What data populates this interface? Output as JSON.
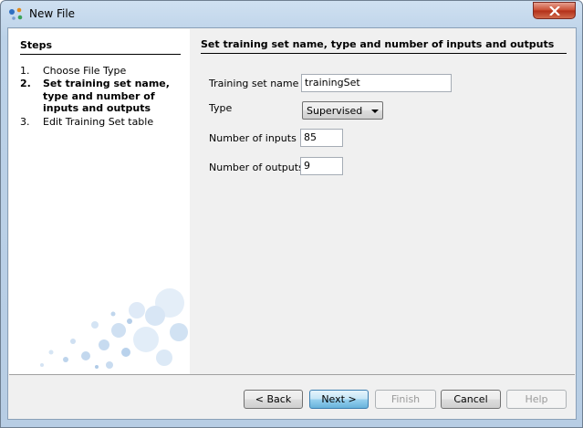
{
  "window": {
    "title": "New File"
  },
  "steps": {
    "title": "Steps",
    "items": [
      {
        "num": "1.",
        "label": "Choose File Type",
        "active": false
      },
      {
        "num": "2.",
        "label": "Set training set name, type and number of inputs and outputs",
        "active": true
      },
      {
        "num": "3.",
        "label": "Edit Training Set table",
        "active": false
      }
    ]
  },
  "content": {
    "title": "Set training set name, type and number of inputs and outputs",
    "fields": {
      "name_label": "Training set name",
      "name_value": "trainingSet",
      "type_label": "Type",
      "type_value": "Supervised",
      "inputs_label": "Number of inputs",
      "inputs_value": "85",
      "outputs_label": "Number of outputs",
      "outputs_value": "9"
    }
  },
  "buttons": {
    "back": "< Back",
    "next": "Next >",
    "finish": "Finish",
    "cancel": "Cancel",
    "help": "Help"
  },
  "colors": {
    "titlebar": "#bcd2e8",
    "close": "#c8492f",
    "default_button": "#98d1ef"
  }
}
